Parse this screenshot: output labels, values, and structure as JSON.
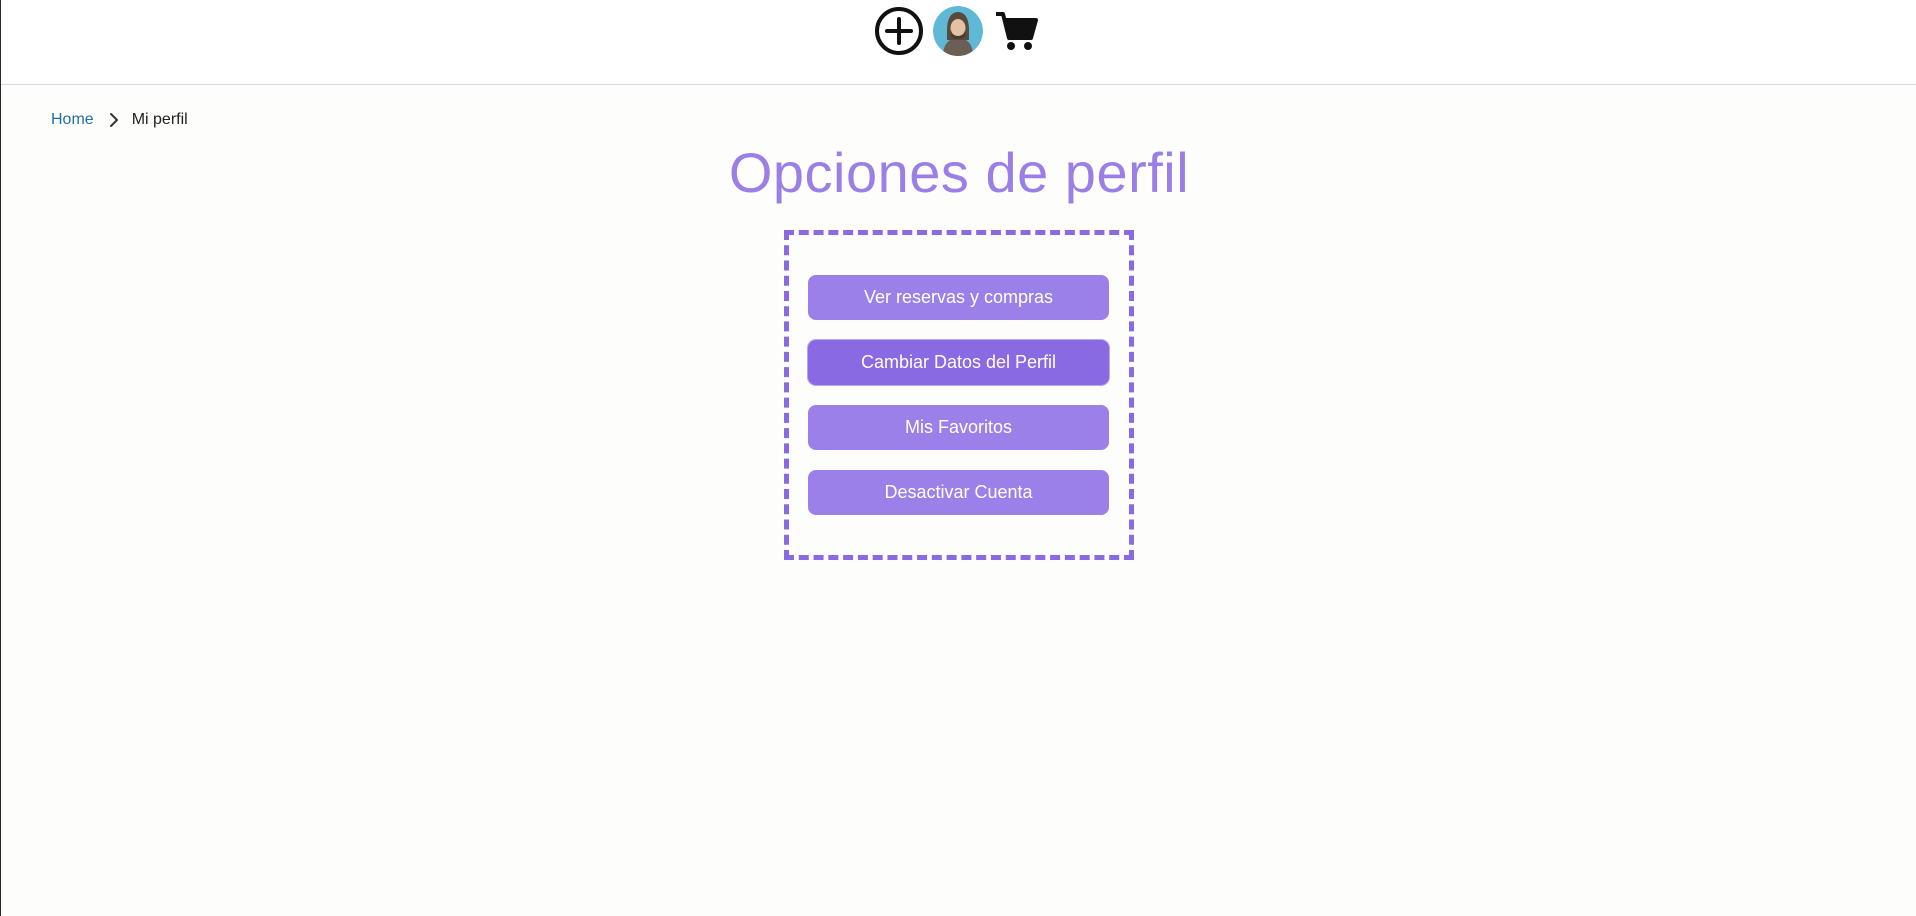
{
  "header": {
    "icons": {
      "add": "add-circle-icon",
      "avatar": "user-avatar",
      "cart": "shopping-cart-icon"
    }
  },
  "breadcrumb": {
    "home": "Home",
    "current": "Mi perfil"
  },
  "page": {
    "title": "Opciones de perfil"
  },
  "options": [
    {
      "label": "Ver reservas y compras"
    },
    {
      "label": "Cambiar Datos del Perfil"
    },
    {
      "label": "Mis Favoritos"
    },
    {
      "label": "Desactivar Cuenta"
    }
  ],
  "colors": {
    "accent": "#9a80e8",
    "accent_dark": "#8a6ae3",
    "title": "#9b7fe6",
    "link": "#1f6fa8"
  }
}
